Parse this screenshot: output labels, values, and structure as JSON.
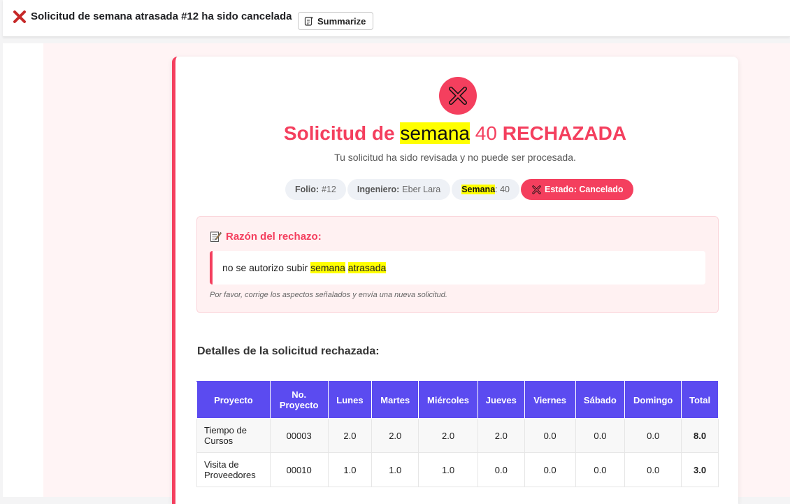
{
  "header": {
    "subject": "Solicitud de semana atrasada #12 ha sido cancelada",
    "summarize_label": "Summarize"
  },
  "hero": {
    "title_prefix": "Solicitud de",
    "title_highlight": "semana",
    "title_number": "40",
    "title_suffix": "RECHAZADA",
    "subtitle": "Tu solicitud ha sido revisada y no puede ser procesada."
  },
  "pills": {
    "folio_label": "Folio:",
    "folio_value": "#12",
    "engineer_label": "Ingeniero:",
    "engineer_value": "Eber Lara",
    "week_label": "Semana",
    "week_value": ": 40",
    "status_label": "Estado: Cancelado"
  },
  "reason": {
    "heading": "Razón del rechazo:",
    "text_prefix": "no se autorizo subir",
    "text_hl1": "semana",
    "text_hl2": "atrasada",
    "note": "Por favor, corrige los aspectos señalados y envía una nueva solicitud."
  },
  "details": {
    "title": "Detalles de la solicitud rechazada:",
    "columns": [
      "Proyecto",
      "No. Proyecto",
      "Lunes",
      "Martes",
      "Miércoles",
      "Jueves",
      "Viernes",
      "Sábado",
      "Domingo",
      "Total"
    ],
    "rows": [
      [
        "Tiempo de Cursos",
        "00003",
        "2.0",
        "2.0",
        "2.0",
        "2.0",
        "0.0",
        "0.0",
        "0.0",
        "8.0"
      ],
      [
        "Visita de Proveedores",
        "00010",
        "1.0",
        "1.0",
        "1.0",
        "0.0",
        "0.0",
        "0.0",
        "0.0",
        "3.0"
      ]
    ]
  },
  "colors": {
    "accent": "#f43f5e",
    "table_header": "#5b4bf0",
    "highlight": "#ffff00"
  }
}
